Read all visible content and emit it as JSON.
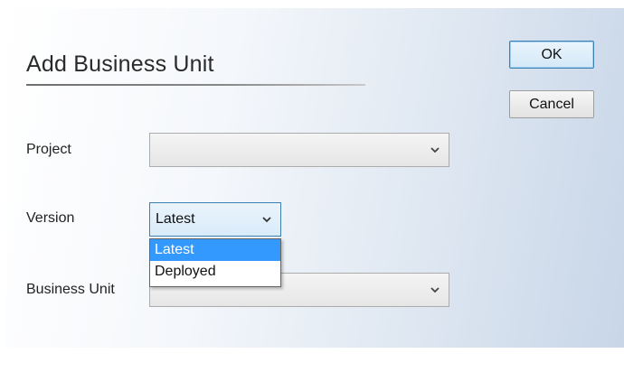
{
  "dialog": {
    "title": "Add Business Unit",
    "ok_label": "OK",
    "cancel_label": "Cancel"
  },
  "fields": {
    "project": {
      "label": "Project",
      "value": ""
    },
    "version": {
      "label": "Version",
      "value": "Latest",
      "options": [
        "Latest",
        "Deployed"
      ],
      "highlighted_option": "Latest",
      "expanded": true
    },
    "business_unit": {
      "label": "Business Unit",
      "value": ""
    }
  },
  "icons": {
    "combo_arrow": "chevron-down-icon"
  },
  "colors": {
    "selection": "#3399ff",
    "default_button_border": "#3c7fb1"
  }
}
